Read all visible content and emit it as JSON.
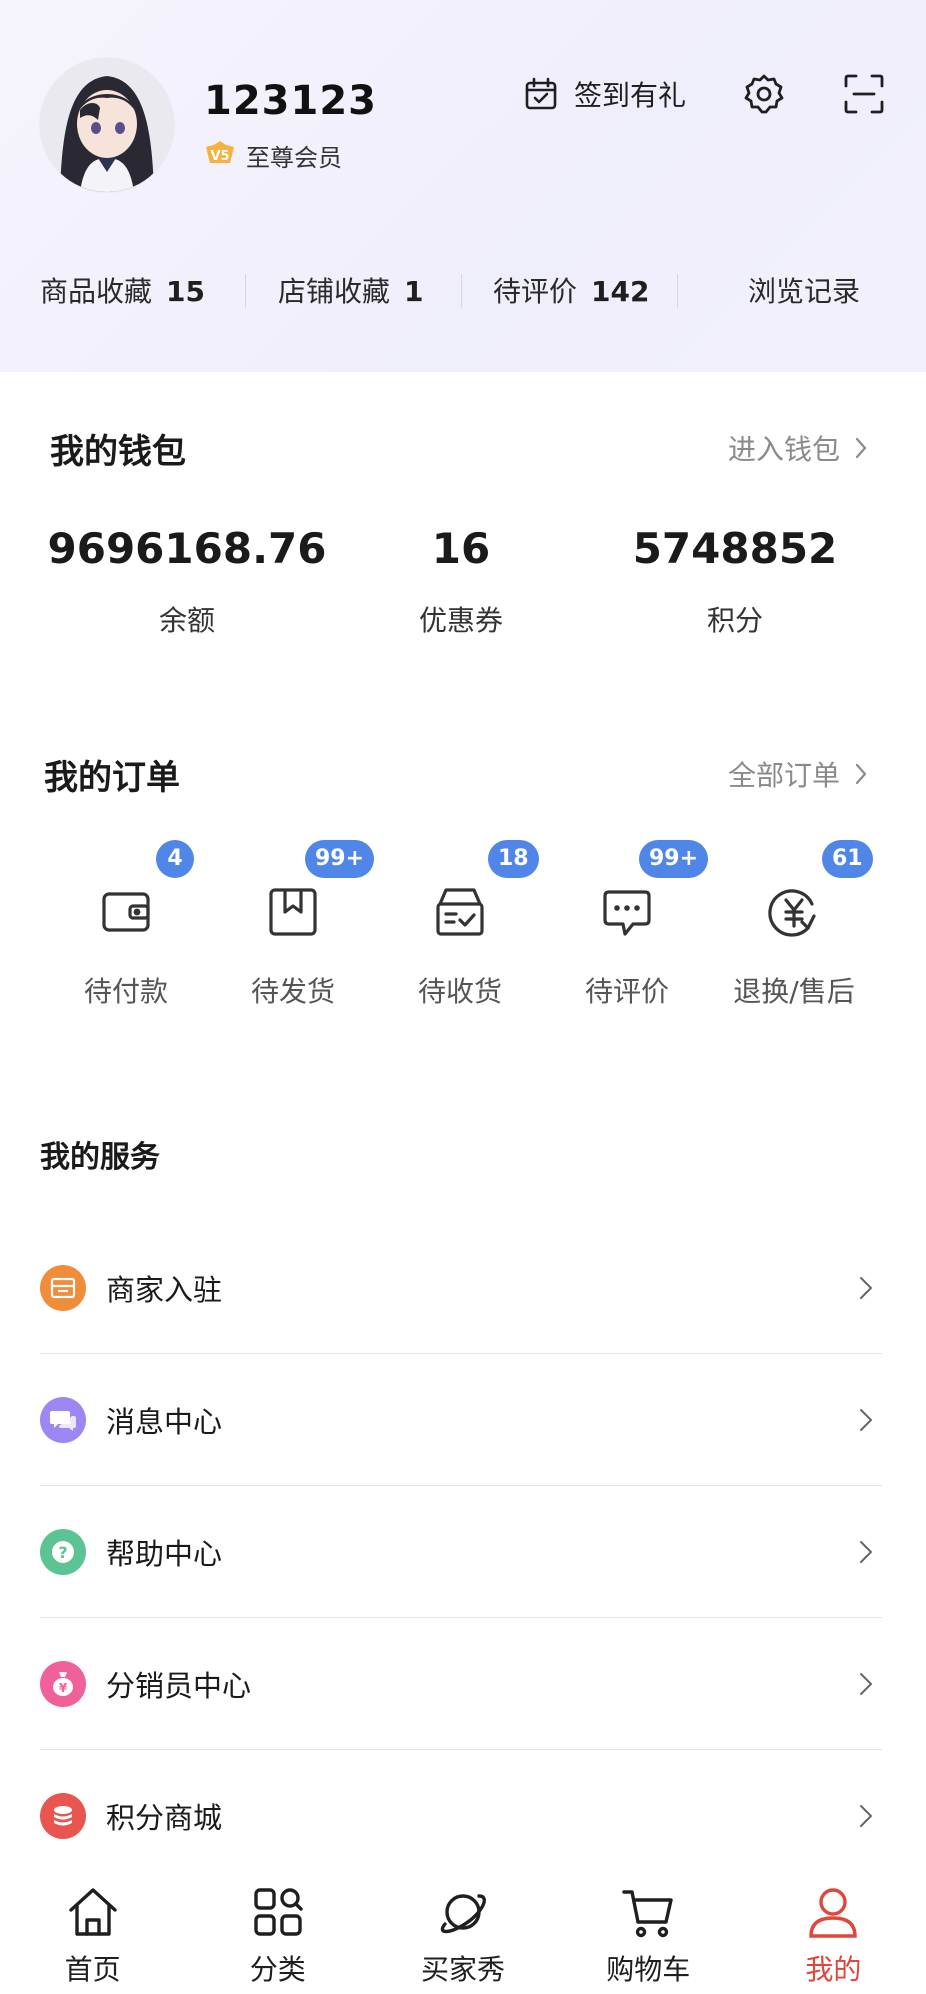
{
  "profile": {
    "username": "123123",
    "member_label": "至尊会员",
    "member_badge_text": "V5"
  },
  "top_actions": {
    "checkin_label": "签到有礼"
  },
  "stats": [
    {
      "label": "商品收藏",
      "value": "15"
    },
    {
      "label": "店铺收藏",
      "value": "1"
    },
    {
      "label": "待评价",
      "value": "142"
    },
    {
      "label": "浏览记录",
      "value": ""
    }
  ],
  "wallet": {
    "title": "我的钱包",
    "link": "进入钱包",
    "items": [
      {
        "value": "9696168.76",
        "label": "余额"
      },
      {
        "value": "16",
        "label": "优惠券"
      },
      {
        "value": "5748852",
        "label": "积分"
      }
    ]
  },
  "orders": {
    "title": "我的订单",
    "link": "全部订单",
    "items": [
      {
        "label": "待付款",
        "badge": "4",
        "icon": "wallet-icon"
      },
      {
        "label": "待发货",
        "badge": "99+",
        "icon": "package-icon"
      },
      {
        "label": "待收货",
        "badge": "18",
        "icon": "delivery-box-icon"
      },
      {
        "label": "待评价",
        "badge": "99+",
        "icon": "comment-icon"
      },
      {
        "label": "退换/售后",
        "badge": "61",
        "icon": "refund-icon"
      }
    ]
  },
  "services": {
    "title": "我的服务",
    "items": [
      {
        "label": "商家入驻",
        "icon": "store-icon",
        "color": "#ef8d3b"
      },
      {
        "label": "消息中心",
        "icon": "message-icon",
        "color": "#9d87f2"
      },
      {
        "label": "帮助中心",
        "icon": "help-icon",
        "color": "#5cc494"
      },
      {
        "label": "分销员中心",
        "icon": "money-bag-icon",
        "color": "#f0609a"
      },
      {
        "label": "积分商城",
        "icon": "coins-icon",
        "color": "#e8564f"
      }
    ]
  },
  "tabbar": {
    "items": [
      {
        "label": "首页",
        "icon": "home-icon"
      },
      {
        "label": "分类",
        "icon": "category-icon"
      },
      {
        "label": "买家秀",
        "icon": "planet-icon"
      },
      {
        "label": "购物车",
        "icon": "cart-icon"
      },
      {
        "label": "我的",
        "icon": "user-icon"
      }
    ],
    "active_color": "#e0473b"
  }
}
